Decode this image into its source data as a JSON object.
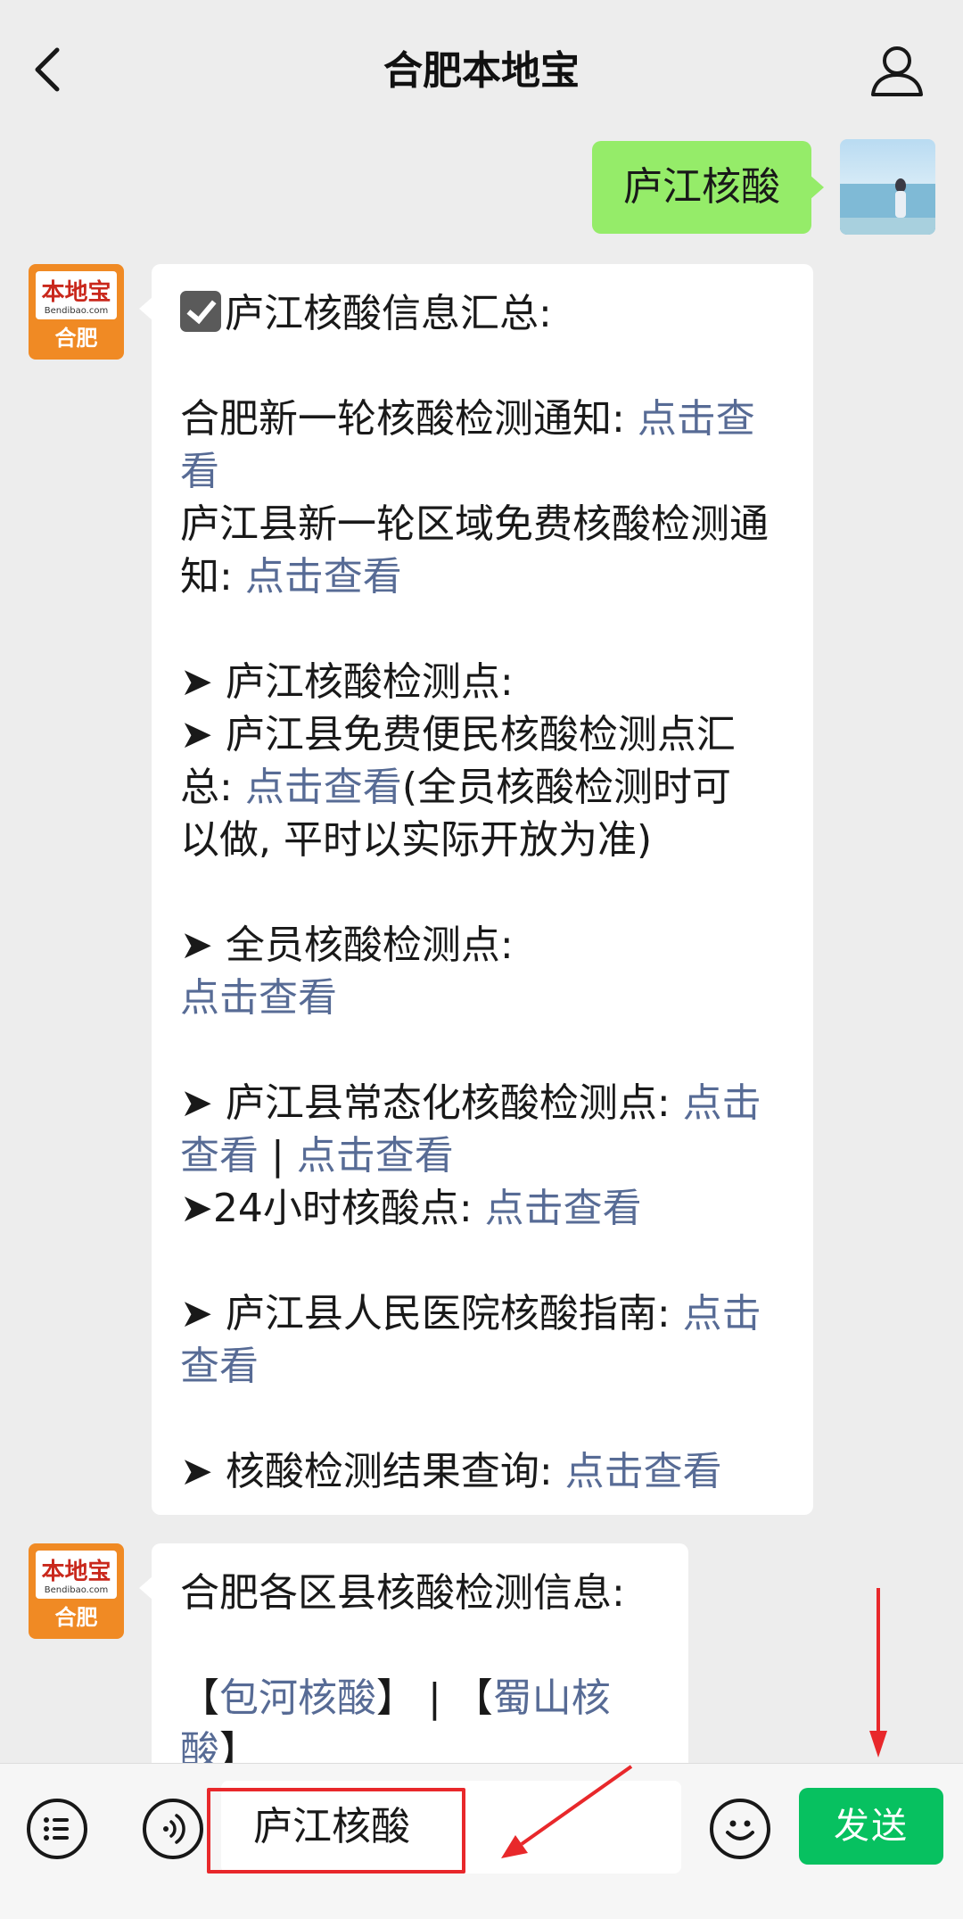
{
  "header": {
    "title": "合肥本地宝",
    "back_icon": "chevron-left-icon",
    "profile_icon": "user-icon"
  },
  "sent_message": {
    "text": "庐江核酸"
  },
  "bot_avatar": {
    "name": "本地宝",
    "url": "Bendibao.com",
    "city": "合肥"
  },
  "message1": {
    "lines": [
      [
        {
          "t": "庐江核酸信息汇总:"
        }
      ],
      [],
      [
        {
          "t": "合肥新一轮核酸检测通知: "
        },
        {
          "t": "点击查",
          "link": true
        }
      ],
      [
        {
          "t": "看",
          "link": true
        }
      ],
      [
        {
          "t": "庐江县新一轮区域免费核酸检测通"
        }
      ],
      [
        {
          "t": "知: "
        },
        {
          "t": "点击查看",
          "link": true
        }
      ],
      [],
      [
        {
          "t": "➤ 庐江核酸检测点:"
        }
      ],
      [
        {
          "t": "➤ 庐江县免费便民核酸检测点汇"
        }
      ],
      [
        {
          "t": "总: "
        },
        {
          "t": "点击查看",
          "link": true
        },
        {
          "t": "(全员核酸检测时可"
        }
      ],
      [
        {
          "t": "以做, 平时以实际开放为准)"
        }
      ],
      [],
      [
        {
          "t": "➤ 全员核酸检测点:"
        }
      ],
      [
        {
          "t": "点击查看",
          "link": true
        }
      ],
      [],
      [
        {
          "t": "➤ 庐江县常态化核酸检测点: "
        },
        {
          "t": "点击",
          "link": true
        }
      ],
      [
        {
          "t": "查看",
          "link": true
        },
        {
          "t": " | "
        },
        {
          "t": "点击查看",
          "link": true
        }
      ],
      [
        {
          "t": "➤24小时核酸点: "
        },
        {
          "t": "点击查看",
          "link": true
        }
      ],
      [],
      [
        {
          "t": "➤ 庐江县人民医院核酸指南: "
        },
        {
          "t": "点击",
          "link": true
        }
      ],
      [
        {
          "t": "查看",
          "link": true
        }
      ],
      [],
      [
        {
          "t": "➤ 核酸检测结果查询: "
        },
        {
          "t": "点击查看",
          "link": true
        }
      ]
    ]
  },
  "message2": {
    "lines": [
      [
        {
          "t": "合肥各区县核酸检测信息:"
        }
      ],
      [],
      [
        {
          "t": "【"
        },
        {
          "t": "包河核酸",
          "link": true
        },
        {
          "t": "】 | 【"
        },
        {
          "t": "蜀山核",
          "link": true
        }
      ],
      [
        {
          "t": "酸",
          "link": true
        },
        {
          "t": "】"
        }
      ]
    ]
  },
  "input": {
    "value": "庐江核酸"
  },
  "send_button": {
    "label": "发送"
  },
  "icons": {
    "menu": "list-icon",
    "voice": "voice-icon",
    "emoji": "emoji-icon"
  },
  "colors": {
    "accent_green": "#07c160",
    "bubble_green": "#95ec69",
    "link": "#576b95",
    "annotation_red": "#e8282b"
  }
}
